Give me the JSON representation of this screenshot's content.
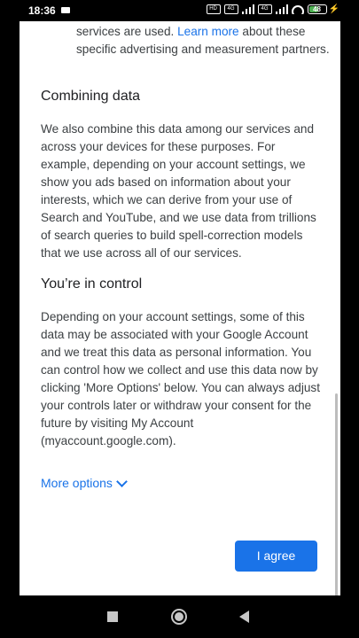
{
  "status_bar": {
    "time": "18:36",
    "network_1": "4G",
    "network_2": "4G",
    "battery": "48"
  },
  "content": {
    "lead_text": "services are used.",
    "lead_link": "Learn more",
    "lead_text_after": "about these specific advertising and measurement partners.",
    "section1_title": "Combining data",
    "section1_body": "We also combine this data among our services and across your devices for these purposes. For example, depending on your account settings, we show you ads based on information about your interests, which we can derive from your use of Search and YouTube, and we use data from trillions of search queries to build spell-correction models that we use across all of our services.",
    "section2_title": "You’re in control",
    "section2_body": "Depending on your account settings, some of this data may be associated with your Google Account and we treat this data as personal information. You can control how we collect and use this data now by clicking 'More Options' below. You can always adjust your controls later or withdraw your consent for the future by visiting My Account (myaccount.google.com)."
  },
  "actions": {
    "more_options": "More options",
    "agree": "I agree"
  },
  "colors": {
    "accent": "#1a73e8",
    "text": "#3c4043",
    "battery": "#4caf50"
  },
  "icons": [
    "video-record-icon",
    "signal-icon",
    "wifi-icon",
    "battery-icon",
    "chevron-down-icon",
    "recent-apps-icon",
    "home-icon",
    "back-icon"
  ]
}
